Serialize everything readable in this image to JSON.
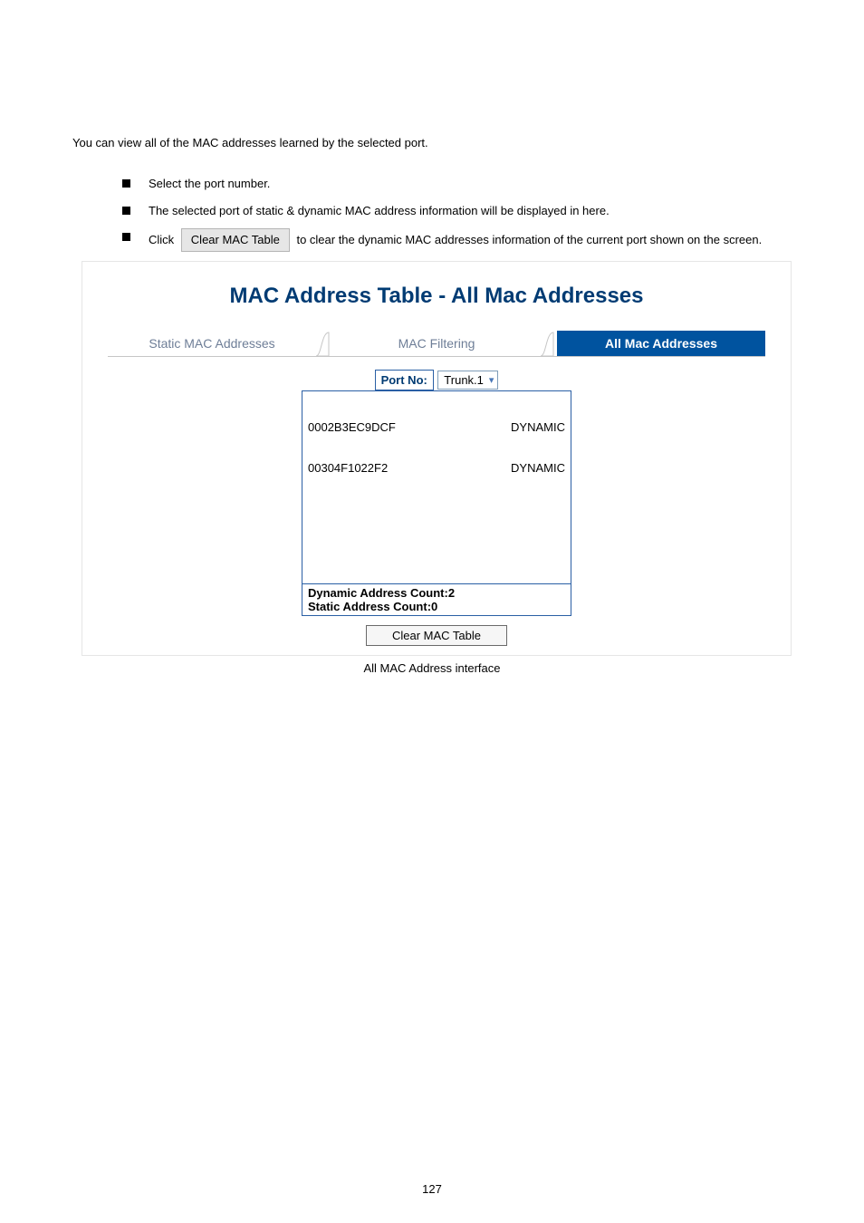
{
  "intro": "You can view all of the MAC addresses learned by the selected port.",
  "bullets": {
    "b1": "Select the port number.",
    "b2": "The selected port of static & dynamic MAC address information will be displayed in here.",
    "b3_prefix": "Click",
    "b3_button": "Clear MAC Table",
    "b3_suffix": " to clear the dynamic MAC addresses information of the current port shown on the screen."
  },
  "panel": {
    "title": "MAC Address Table - All Mac Addresses",
    "tabs": {
      "static": "Static MAC Addresses",
      "filtering": "MAC Filtering",
      "all": "All Mac Addresses"
    },
    "port_label": "Port No:",
    "port_value": "Trunk.1",
    "rows": [
      {
        "mac": "0002B3EC9DCF",
        "type": "DYNAMIC"
      },
      {
        "mac": "00304F1022F2",
        "type": "DYNAMIC"
      }
    ],
    "counts": {
      "dynamic_label": "Dynamic Address Count:",
      "dynamic_value": "2",
      "static_label": "Static Address Count:",
      "static_value": "0"
    },
    "clear_button": "Clear MAC Table"
  },
  "caption": "All MAC Address interface",
  "page_number": "127"
}
